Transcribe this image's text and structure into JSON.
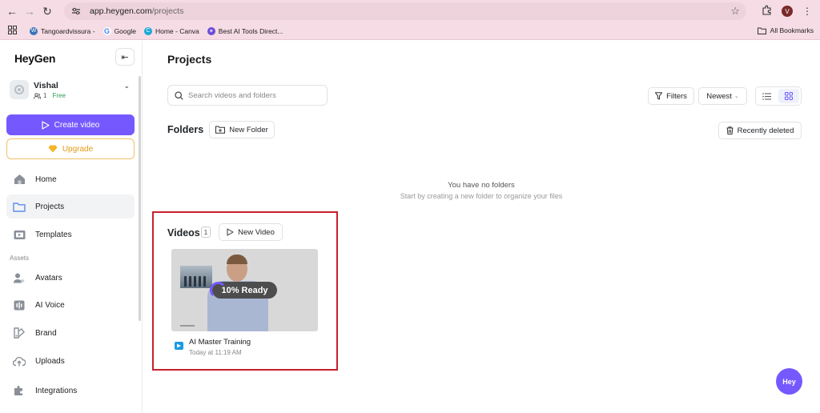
{
  "browser": {
    "url_host": "app.heygen.com",
    "url_path": "/projects",
    "profile_initial": "V",
    "bookmarks": [
      {
        "label": "Tangoardvissura -",
        "icon": "wordpress-icon"
      },
      {
        "label": "Google",
        "icon": "google-icon"
      },
      {
        "label": "Home - Canva",
        "icon": "canva-icon"
      },
      {
        "label": "Best AI Tools Direct...",
        "icon": "ai-tools-icon"
      }
    ],
    "all_bookmarks": "All Bookmarks"
  },
  "sidebar": {
    "logo": "HeyGen",
    "workspace": {
      "name": "Vishal",
      "members": "1",
      "plan": "Free"
    },
    "create_video": "Create video",
    "upgrade": "Upgrade",
    "nav": [
      {
        "label": "Home"
      },
      {
        "label": "Projects"
      },
      {
        "label": "Templates"
      }
    ],
    "assets_label": "Assets",
    "assets": [
      {
        "label": "Avatars"
      },
      {
        "label": "AI Voice"
      },
      {
        "label": "Brand"
      },
      {
        "label": "Uploads"
      },
      {
        "label": "Integrations"
      }
    ]
  },
  "main": {
    "title": "Projects",
    "search_placeholder": "Search videos and folders",
    "filters": "Filters",
    "sort": "Newest",
    "folders": {
      "title": "Folders",
      "new_folder": "New Folder",
      "recently_deleted": "Recently deleted",
      "empty_title": "You have no folders",
      "empty_subtitle": "Start by creating a new folder to organize your files"
    },
    "videos": {
      "title": "Videos",
      "count": "1",
      "new_video": "New Video",
      "items": [
        {
          "title": "AI Master Training",
          "time": "Today at 11:19 AM",
          "status": "10% Ready",
          "progress": 0.1
        }
      ]
    },
    "fab": "Hey"
  },
  "colors": {
    "accent": "#7559ff",
    "upgrade": "#e39b18",
    "highlight": "#c8202b",
    "chrome": "#f6dce4"
  }
}
